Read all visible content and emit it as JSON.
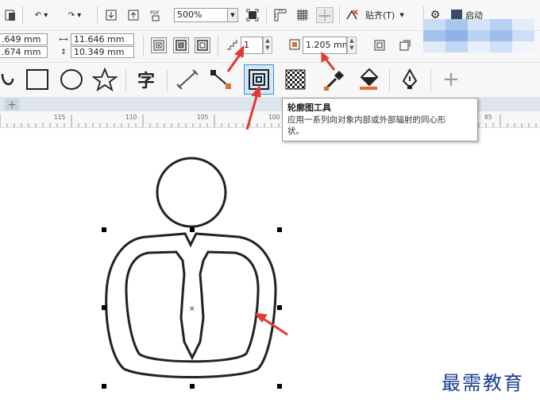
{
  "toolbar": {
    "zoom_value": "500%",
    "snap_label": "贴齐(T)",
    "partial_menu_label": "启动"
  },
  "property_bar": {
    "x_value": ".649 mm",
    "y_value": ".674 mm",
    "width_value": "11.646 mm",
    "height_value": "10.349 mm",
    "contour_steps": "1",
    "contour_offset": "1.205 mm"
  },
  "tooltip": {
    "title": "轮廓图工具",
    "description_line1": "应用一系列向对象内部或外部辐射的同心形",
    "description_line2": "状。"
  },
  "ruler": {
    "ticks": [
      "115",
      "110",
      "105",
      "100",
      "85"
    ]
  },
  "watermark": {
    "text": "最需教育"
  },
  "colors": {
    "annotation_arrow": "#e53935",
    "selected_tool_border": "#3d8fd6",
    "watermark": "#1c3d94",
    "blurred_block": "#8fb3e8"
  }
}
